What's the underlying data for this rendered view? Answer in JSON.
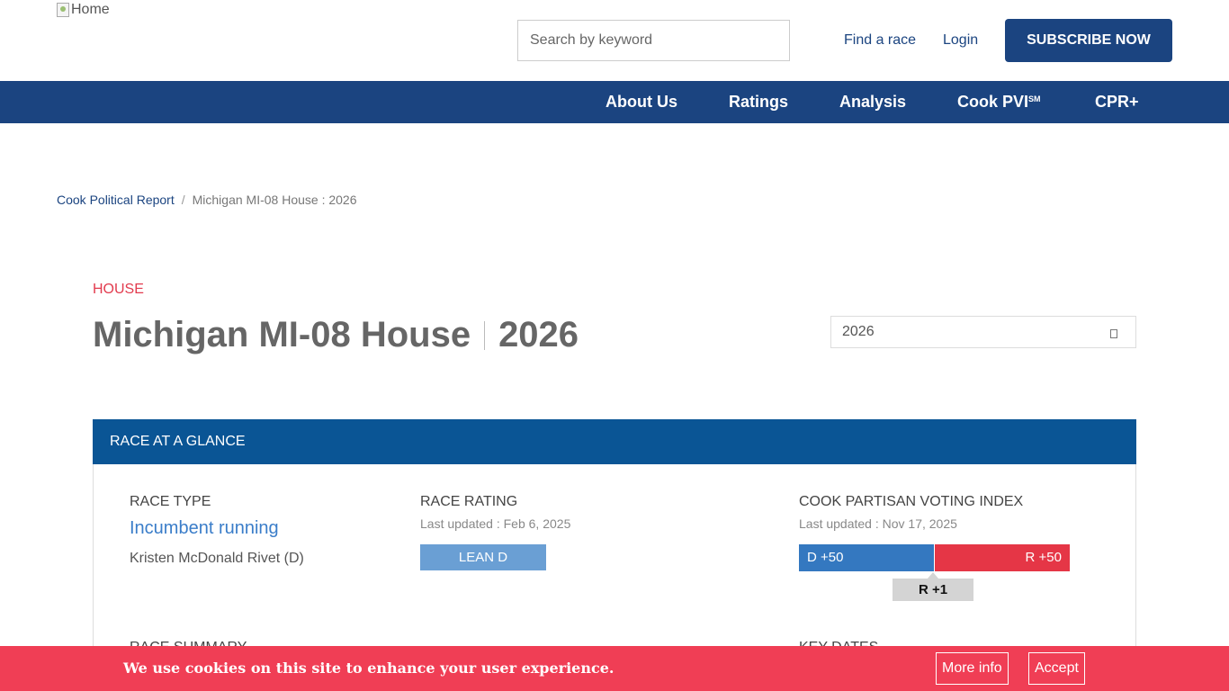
{
  "header": {
    "logo_alt": "Home",
    "search_placeholder": "Search by keyword",
    "find_race": "Find a race",
    "login": "Login",
    "subscribe": "SUBSCRIBE NOW"
  },
  "nav": {
    "items": [
      {
        "label": "About Us"
      },
      {
        "label": "Ratings"
      },
      {
        "label": "Analysis"
      },
      {
        "label": "Cook PVI",
        "superscript": "SM"
      },
      {
        "label": "CPR+"
      }
    ]
  },
  "breadcrumb": {
    "home": "Cook Political Report",
    "separator": "/",
    "current": "Michigan MI-08 House : 2026"
  },
  "race": {
    "category": "HOUSE",
    "title": "Michigan MI-08 House",
    "year": "2026",
    "year_select_value": "2026"
  },
  "glance": {
    "header": "RACE AT A GLANCE",
    "race_type": {
      "label": "RACE TYPE",
      "value": "Incumbent running",
      "incumbent": "Kristen McDonald Rivet (D)"
    },
    "race_rating": {
      "label": "RACE RATING",
      "updated": "Last updated : Feb 6, 2025",
      "rating": "LEAN D",
      "color": "#6a9fd4"
    },
    "pvi": {
      "label": "COOK PARTISAN VOTING INDEX",
      "updated": "Last updated : Nov 17, 2025",
      "d_label": "D +50",
      "r_label": "R +50",
      "score": "R +1",
      "d_color": "#3478c0",
      "r_color": "#e53646"
    },
    "race_summary_label": "RACE SUMMARY",
    "key_dates_label": "KEY DATES"
  },
  "cookie": {
    "text": "We use cookies on this site to enhance your user experience.",
    "more_info": "More info",
    "accept": "Accept"
  },
  "colors": {
    "brand_navy": "#1b4480",
    "glance_blue": "#0a5595",
    "accent_red": "#e23b4e",
    "cookie_bg": "#f03e55"
  }
}
